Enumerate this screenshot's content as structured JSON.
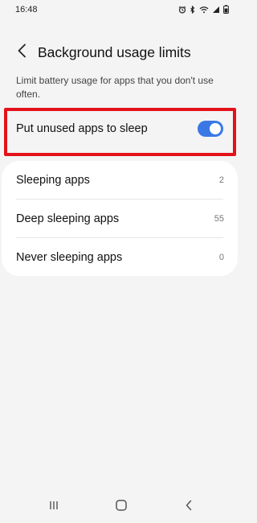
{
  "status_bar": {
    "time": "16:48",
    "icons": [
      "alarm-icon",
      "bluetooth-icon",
      "wifi-icon",
      "signal-icon",
      "battery-icon"
    ]
  },
  "header": {
    "title": "Background usage limits",
    "back_icon": "back-arrow-icon"
  },
  "description": "Limit battery usage for apps that you don't use often.",
  "sleep_toggle": {
    "label": "Put unused apps to sleep",
    "enabled": true,
    "accent_color": "#3a78e6",
    "highlight_color": "#e3121a"
  },
  "app_lists": {
    "items": [
      {
        "label": "Sleeping apps",
        "count": "2"
      },
      {
        "label": "Deep sleeping apps",
        "count": "55"
      },
      {
        "label": "Never sleeping apps",
        "count": "0"
      }
    ]
  },
  "nav_bar": {
    "icons": [
      "recents-icon",
      "home-icon",
      "back-icon"
    ]
  }
}
